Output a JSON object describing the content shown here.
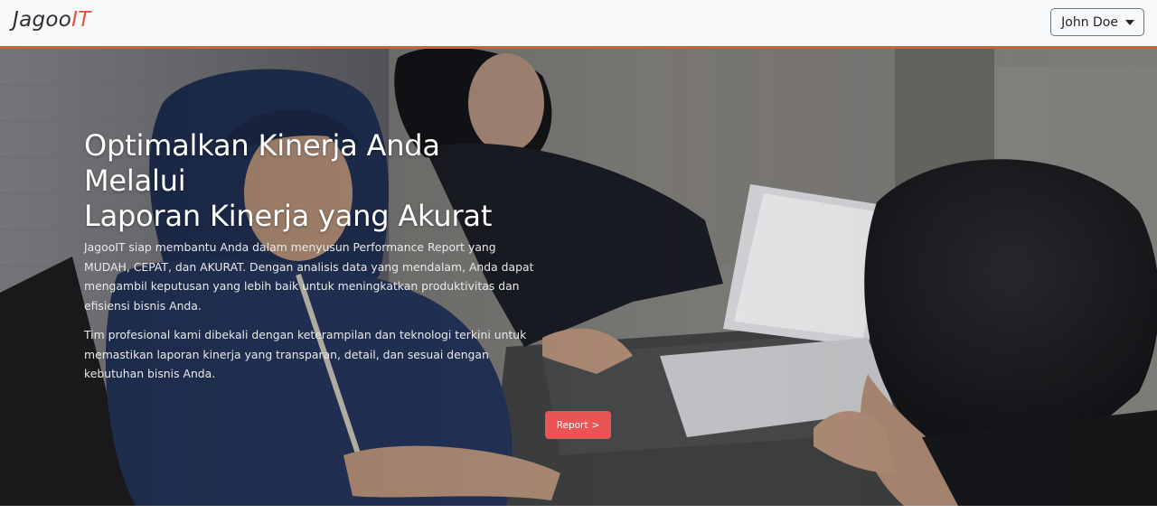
{
  "navbar": {
    "brand_main": "Jagoo",
    "brand_accent": "IT",
    "user_label": "John Doe"
  },
  "hero": {
    "title_line1": "Optimalkan Kinerja Anda Melalui",
    "title_line2": "Laporan Kinerja yang Akurat",
    "paragraph1": "JagooIT siap membantu Anda dalam menyusun Performance Report yang MUDAH, CEPAT, dan AKURAT. Dengan analisis data yang mendalam, Anda dapat mengambil keputusan yang lebih baik untuk meningkatkan produktivitas dan efisiensi bisnis Anda.",
    "paragraph2": "Tim profesional kami dibekali dengan keterampilan dan teknologi terkini untuk memastikan laporan kinerja yang transparan, detail, dan sesuai dengan kebutuhan bisnis Anda.",
    "button_label": "Report",
    "button_arrow": ">"
  },
  "colors": {
    "accent": "#e4533f",
    "button": "#ea5455",
    "navbar_bg": "#f8f9fa"
  },
  "icons": {
    "user_menu": "caret-down-icon"
  }
}
